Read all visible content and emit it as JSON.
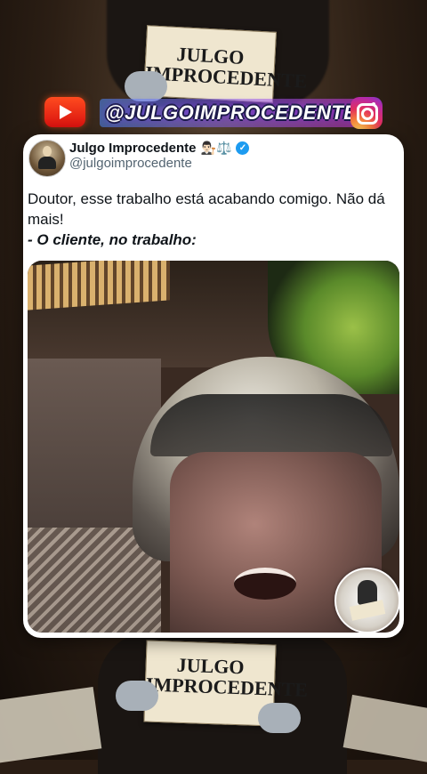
{
  "background": {
    "sign_top_text": "JULGO IMPROCEDENTE",
    "sign_bottom_text": "JULGO IMPROCEDENTE"
  },
  "social_bar": {
    "handle": "@JULGOIMPROCEDENTE",
    "youtube_icon": "youtube-icon",
    "instagram_icon": "instagram-icon"
  },
  "tweet": {
    "author_name": "Julgo Improcedente",
    "author_emoji": "👨🏻‍⚖️⚖️",
    "username": "@julgoimprocedente",
    "verified": true,
    "text": "Doutor, esse trabalho está acabando comigo. Não dá mais!",
    "quote_line": "- O cliente, no trabalho:",
    "media_description_icon": "video-frame"
  },
  "colors": {
    "card_bg": "#ffffff",
    "verified_blue": "#1d9bf0",
    "youtube_red": "#e32417",
    "name_color": "#0f1419",
    "username_color": "#536471"
  }
}
